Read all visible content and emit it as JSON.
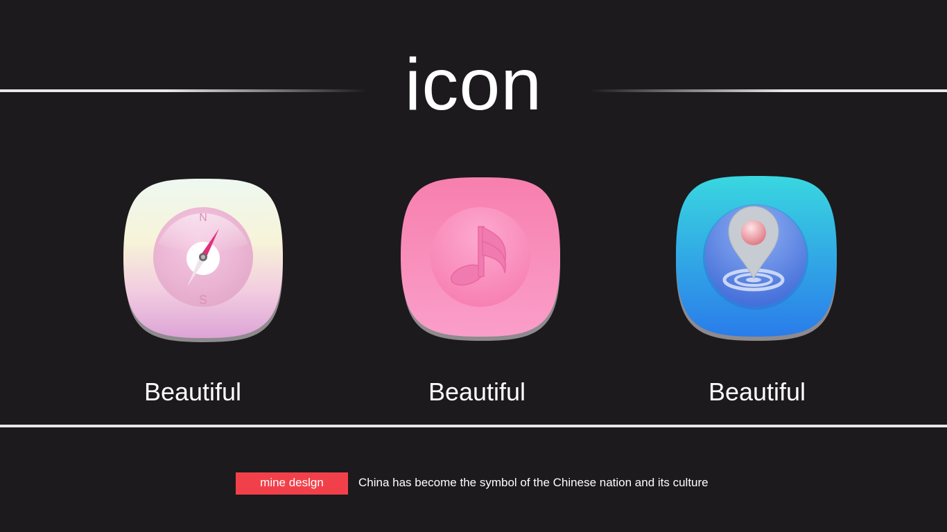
{
  "header": {
    "title": "icon"
  },
  "icons": [
    {
      "icon": "compass-icon",
      "label": "Beautiful",
      "compass_n": "N",
      "compass_s": "S"
    },
    {
      "icon": "music-note-icon",
      "label": "Beautiful"
    },
    {
      "icon": "location-pin-icon",
      "label": "Beautiful"
    }
  ],
  "footer": {
    "badge": "mine deslgn",
    "text": "China has become the symbol of the Chinese nation and its culture"
  },
  "colors": {
    "background": "#1c1a1d",
    "badge": "#f2404a",
    "lines": "#ece6ee"
  }
}
